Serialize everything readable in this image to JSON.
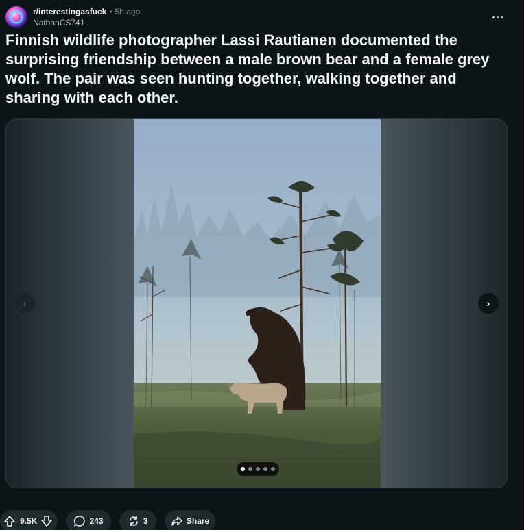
{
  "post": {
    "subreddit": "r/interestingasfuck",
    "separator": "•",
    "time": "5h ago",
    "author": "NathanCS741",
    "more_label": "...",
    "title": "Finnish wildlife photographer Lassi Rautianen documented the surprising friendship between a male brown bear and a female grey wolf. The pair was seen hunting together, walking together and sharing with each other."
  },
  "gallery": {
    "total_images": 5,
    "current_index": 1,
    "prev_label": "‹",
    "next_label": "›"
  },
  "actions": {
    "upvotes": "9.5K",
    "comments": "243",
    "crossposts": "3",
    "share_label": "Share"
  },
  "colors": {
    "background": "#0b1416",
    "pill_background": "#1f2a2e",
    "text_primary": "#f2f4f5",
    "text_muted": "#82959b"
  }
}
